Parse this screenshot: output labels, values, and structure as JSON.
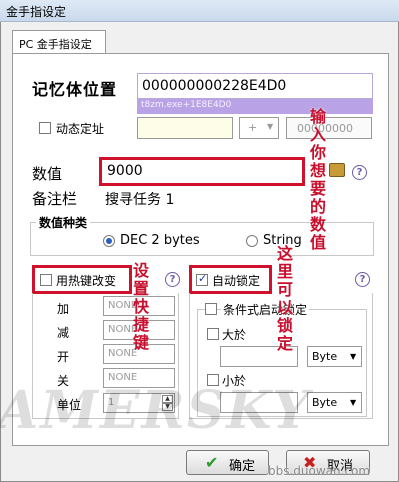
{
  "window": {
    "title": "金手指设定"
  },
  "tab": {
    "label": "PC 金手指设定"
  },
  "address": {
    "label": "记忆体位置",
    "value": "000000000228E4D0",
    "sub": "t8zm.exe+1E8E4D0",
    "dynamic_label": "动态定址",
    "operator": "+",
    "offset": "00000000"
  },
  "value_field": {
    "label": "数值",
    "value": "9000"
  },
  "note_field": {
    "label": "备注栏",
    "value": "搜寻任务 1"
  },
  "value_type": {
    "title": "数值种类",
    "options": [
      {
        "label": "DEC 2 bytes",
        "selected": true
      },
      {
        "label": "String",
        "selected": false
      }
    ]
  },
  "hotkey": {
    "label": "用热键改变",
    "rows": [
      {
        "label": "加",
        "value": "NONE"
      },
      {
        "label": "减",
        "value": "NONE"
      },
      {
        "label": "开",
        "value": "NONE"
      },
      {
        "label": "关",
        "value": "NONE"
      }
    ],
    "unit_label": "单位",
    "unit_value": "1"
  },
  "autolock": {
    "label": "自动锁定",
    "conditional_label": "条件式启动锁定",
    "greater_label": "大於",
    "less_label": "小於",
    "type_1": "Byte",
    "type_2": "Byte"
  },
  "buttons": {
    "ok": "确定",
    "cancel": "取消"
  },
  "annotations": {
    "input_value": "输入你想要的数值",
    "set_hotkey": "设置快捷键",
    "lockable": "这里可以锁定"
  },
  "watermarks": {
    "gamersky": "AMERSKY",
    "duowan": "bbs.duowan.com"
  },
  "colors": {
    "highlight": "#d0112b",
    "address_sub_bg": "#b9a3e6",
    "ok_check": "#2e9a2e",
    "cancel_x": "#c62020"
  }
}
